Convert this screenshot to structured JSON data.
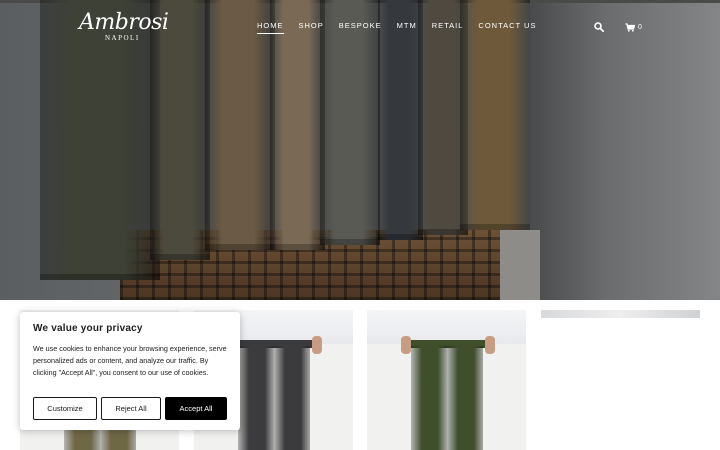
{
  "brand": {
    "name": "Ambrosi",
    "subtitle": "NAPOLI"
  },
  "nav": {
    "items": [
      {
        "label": "HOME",
        "active": true
      },
      {
        "label": "SHOP",
        "active": false
      },
      {
        "label": "BESPOKE",
        "active": false
      },
      {
        "label": "MTM",
        "active": false
      },
      {
        "label": "RETAIL",
        "active": false
      },
      {
        "label": "CONTACT US",
        "active": false
      }
    ],
    "search_icon": "search-icon",
    "cart_icon": "cart-icon",
    "cart_count": "0"
  },
  "hero": {
    "trouser_colors": [
      "#3d4136",
      "#4c4a3c",
      "#6b5a45",
      "#7a6a55",
      "#5a5a55",
      "#35383d",
      "#4f4a40",
      "#6e5a3a"
    ]
  },
  "products": [
    {
      "trouser_color": "#6f6845"
    },
    {
      "trouser_color": "#3b3b3d"
    },
    {
      "trouser_color": "#3f4f2c"
    },
    {
      "trouser_color": "#e9e9e9"
    }
  ],
  "cookie_banner": {
    "title": "We value your privacy",
    "text": "We use cookies to enhance your browsing experience, serve personalized ads or content, and analyze our traffic. By clicking \"Accept All\", you consent to our use of cookies.",
    "customize_label": "Customize",
    "reject_label": "Reject All",
    "accept_label": "Accept All"
  },
  "colors": {
    "nav_text": "#ffffff",
    "accept_bg": "#000000"
  }
}
